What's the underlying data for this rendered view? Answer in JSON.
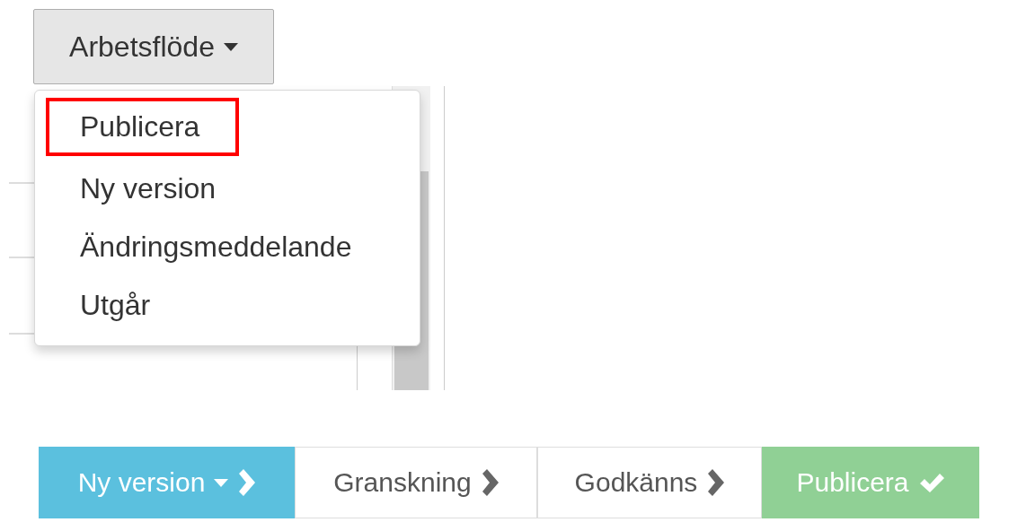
{
  "workflow_button": {
    "label": "Arbetsflöde"
  },
  "menu": {
    "items": [
      {
        "label": "Publicera",
        "highlighted": true
      },
      {
        "label": "Ny version",
        "highlighted": false
      },
      {
        "label": "Ändringsmeddelande",
        "highlighted": false
      },
      {
        "label": "Utgår",
        "highlighted": false
      }
    ]
  },
  "steps": [
    {
      "label": "Ny version",
      "kind": "current",
      "dropdown": true
    },
    {
      "label": "Granskning",
      "kind": "pending",
      "dropdown": false
    },
    {
      "label": "Godkänns",
      "kind": "pending",
      "dropdown": false
    },
    {
      "label": "Publicera",
      "kind": "final",
      "dropdown": false
    }
  ]
}
